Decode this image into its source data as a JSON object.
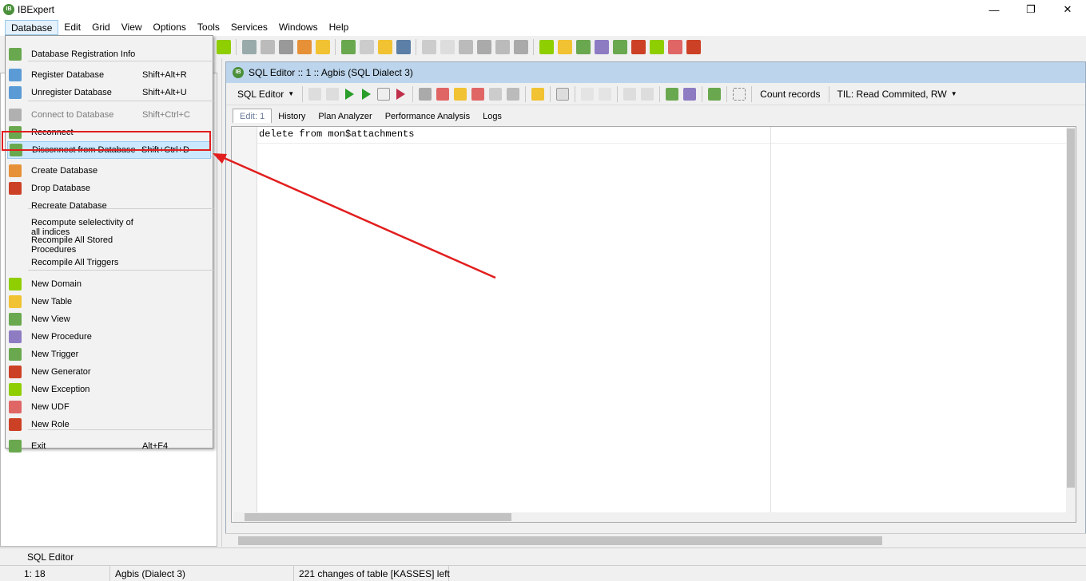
{
  "app": {
    "title": "IBExpert"
  },
  "menubar": [
    "Database",
    "Edit",
    "Grid",
    "View",
    "Options",
    "Tools",
    "Services",
    "Windows",
    "Help"
  ],
  "database_menu": [
    {
      "label": "Database Registration Info",
      "shortcut": "",
      "icon_color": "#6aa84f"
    },
    {
      "label": "Register Database",
      "shortcut": "Shift+Alt+R",
      "icon_color": "#5b9bd5"
    },
    {
      "label": "Unregister Database",
      "shortcut": "Shift+Alt+U",
      "icon_color": "#5b9bd5"
    },
    {
      "label": "Connect to Database",
      "shortcut": "Shift+Ctrl+C",
      "icon_color": "#b0b0b0"
    },
    {
      "label": "Reconnect",
      "shortcut": "",
      "icon_color": "#6aa84f"
    },
    {
      "label": "Disconnect from Database",
      "shortcut": "Shift+Ctrl+D",
      "icon_color": "#6aa84f"
    },
    {
      "label": "Create Database",
      "shortcut": "",
      "icon_color": "#e69138"
    },
    {
      "label": "Drop Database",
      "shortcut": "",
      "icon_color": "#cc4125"
    },
    {
      "label": "Recreate Database",
      "shortcut": "",
      "icon_color": ""
    },
    {
      "label": "Recompute selelectivity of all indices",
      "shortcut": "",
      "icon_color": ""
    },
    {
      "label": "Recompile All Stored Procedures",
      "shortcut": "",
      "icon_color": ""
    },
    {
      "label": "Recompile All Triggers",
      "shortcut": "",
      "icon_color": ""
    },
    {
      "label": "New Domain",
      "shortcut": "",
      "icon_color": "#8fce00"
    },
    {
      "label": "New Table",
      "shortcut": "",
      "icon_color": "#f1c232"
    },
    {
      "label": "New View",
      "shortcut": "",
      "icon_color": "#6aa84f"
    },
    {
      "label": "New Procedure",
      "shortcut": "",
      "icon_color": "#8e7cc3"
    },
    {
      "label": "New Trigger",
      "shortcut": "",
      "icon_color": "#6aa84f"
    },
    {
      "label": "New Generator",
      "shortcut": "",
      "icon_color": "#cc4125"
    },
    {
      "label": "New Exception",
      "shortcut": "",
      "icon_color": "#8fce00"
    },
    {
      "label": "New UDF",
      "shortcut": "",
      "icon_color": "#e06666"
    },
    {
      "label": "New Role",
      "shortcut": "",
      "icon_color": "#cc4125"
    },
    {
      "label": "Exit",
      "shortcut": "Alt+F4",
      "icon_color": "#6aa84f"
    }
  ],
  "editor": {
    "title": "SQL Editor :: 1 :: Agbis (SQL Dialect 3)",
    "sql_editor_btn": "SQL Editor",
    "count_records": "Count records",
    "til": "TIL: Read Commited, RW",
    "tabs": [
      "Edit: 1",
      "History",
      "Plan Analyzer",
      "Performance Analysis",
      "Logs"
    ],
    "code": "delete from mon$attachments"
  },
  "taskbar": {
    "item": "SQL Editor"
  },
  "statusbar": {
    "position": "1:  18",
    "database": "Agbis (Dialect 3)",
    "message": "221 changes of table [KASSES] left"
  },
  "colors": {
    "highlight": "#e21e1e",
    "selection": "#cce8ff",
    "title_active": "#bcd5ec"
  }
}
